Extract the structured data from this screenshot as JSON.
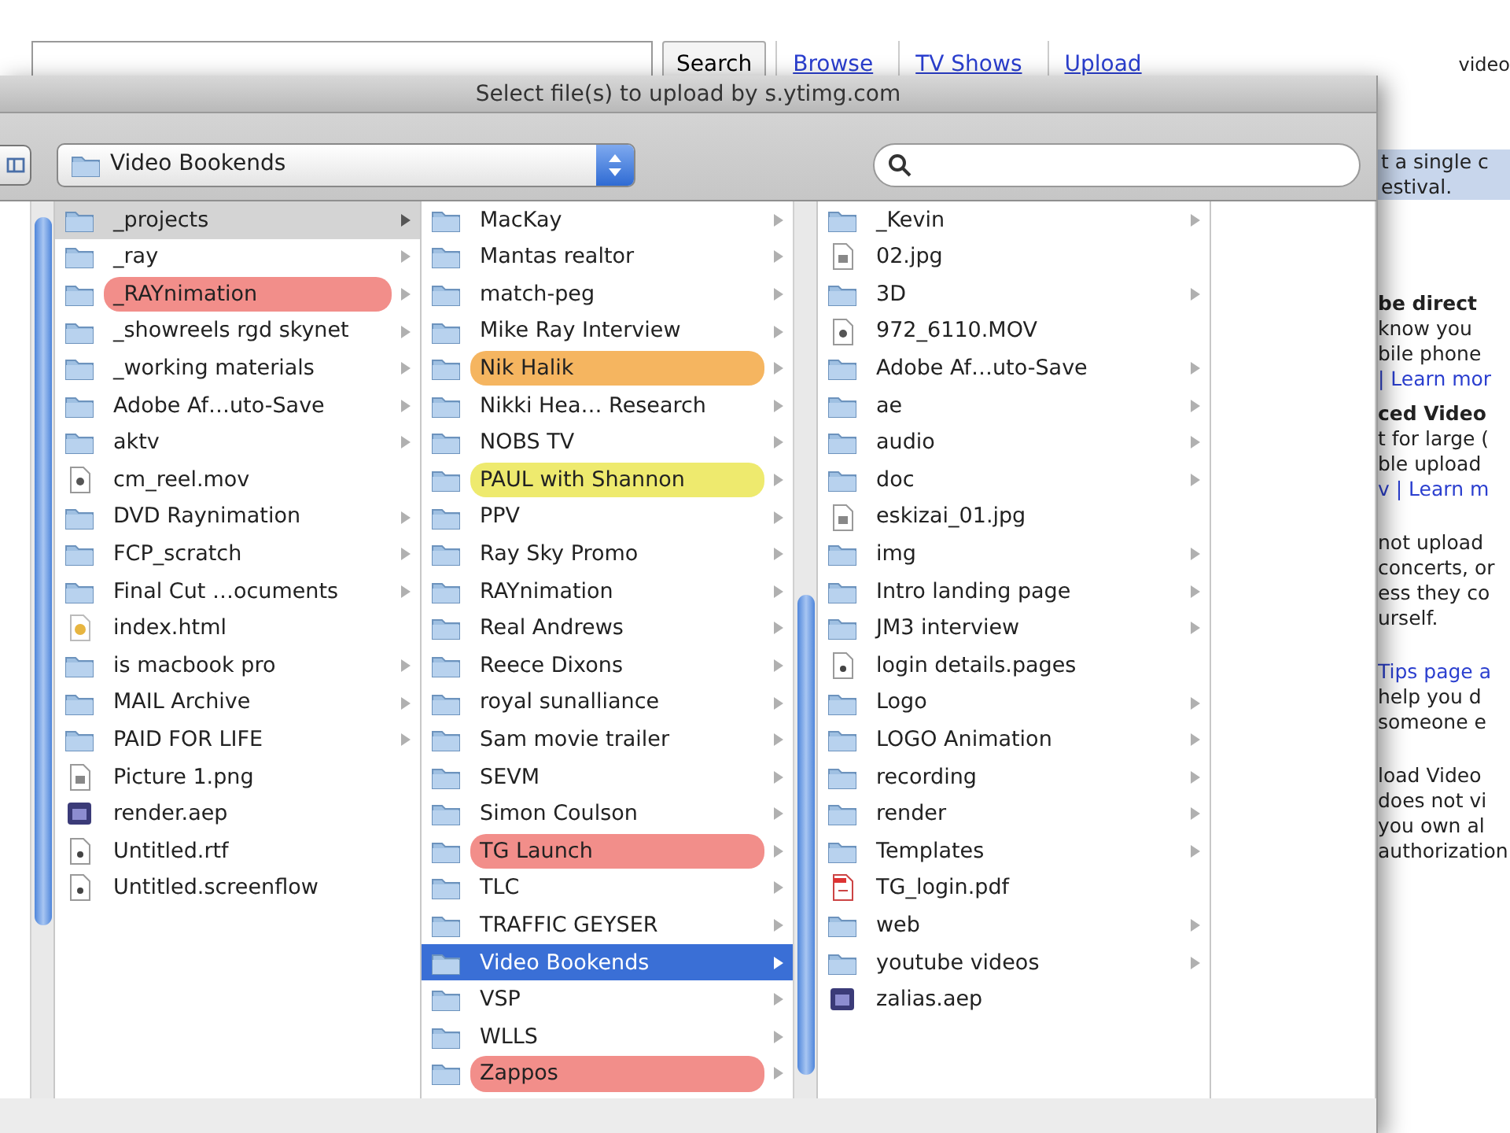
{
  "web_page": {
    "search_button": "Search",
    "nav_links": [
      "Browse",
      "TV Shows",
      "Upload"
    ],
    "account": "video",
    "side_texts": [
      {
        "kind": "notice",
        "text": "t a single c"
      },
      {
        "kind": "notice",
        "text": "estival."
      },
      {
        "kind": "heading",
        "text": "be direct"
      },
      {
        "kind": "text",
        "text": "know you"
      },
      {
        "kind": "text",
        "text": "bile phone"
      },
      {
        "kind": "link",
        "text": "| Learn mor"
      },
      {
        "kind": "heading",
        "text": "ced Video"
      },
      {
        "kind": "text",
        "text": "t for large ("
      },
      {
        "kind": "text",
        "text": "ble upload"
      },
      {
        "kind": "link",
        "text": "v | Learn m"
      },
      {
        "kind": "gap",
        "text": "not upload"
      },
      {
        "kind": "text",
        "text": "concerts, or"
      },
      {
        "kind": "text",
        "text": "ess they co"
      },
      {
        "kind": "text",
        "text": "urself."
      },
      {
        "kind": "link_gap",
        "text": "Tips page a"
      },
      {
        "kind": "text",
        "text": "help you d"
      },
      {
        "kind": "text",
        "text": "someone e"
      },
      {
        "kind": "gap",
        "text": "load Video"
      },
      {
        "kind": "text",
        "text": "does not vi"
      },
      {
        "kind": "text",
        "text": "you own al"
      },
      {
        "kind": "text",
        "text": "authorization"
      }
    ]
  },
  "dialog": {
    "title": "Select file(s) to upload by s.ytimg.com",
    "location": "Video Bookends",
    "columns": [
      {
        "active": false,
        "items": [
          {
            "name": "_projects",
            "kind": "folder",
            "selected": true
          },
          {
            "name": "_ray",
            "kind": "folder",
            "selected": false
          },
          {
            "name": "_RAYnimation",
            "kind": "folder",
            "selected": false,
            "color": "#f28e8a"
          },
          {
            "name": "_showreels rgd skynet",
            "kind": "folder",
            "selected": false
          },
          {
            "name": "_working materials",
            "kind": "folder",
            "selected": false
          },
          {
            "name": "Adobe Af…uto-Save",
            "kind": "folder",
            "selected": false
          },
          {
            "name": "aktv",
            "kind": "folder",
            "selected": false
          },
          {
            "name": "cm_reel.mov",
            "kind": "movie",
            "selected": false
          },
          {
            "name": "DVD Raynimation",
            "kind": "folder",
            "selected": false
          },
          {
            "name": "FCP_scratch",
            "kind": "folder",
            "selected": false
          },
          {
            "name": "Final Cut …ocuments",
            "kind": "folder",
            "selected": false
          },
          {
            "name": "index.html",
            "kind": "html",
            "selected": false
          },
          {
            "name": "is macbook pro",
            "kind": "folder",
            "selected": false
          },
          {
            "name": "MAIL Archive",
            "kind": "folder",
            "selected": false
          },
          {
            "name": "PAID FOR LIFE",
            "kind": "folder",
            "selected": false
          },
          {
            "name": "Picture 1.png",
            "kind": "image",
            "selected": false
          },
          {
            "name": "render.aep",
            "kind": "aep",
            "selected": false
          },
          {
            "name": "Untitled.rtf",
            "kind": "document",
            "selected": false
          },
          {
            "name": "Untitled.screenflow",
            "kind": "document",
            "selected": false
          }
        ]
      },
      {
        "active": true,
        "items": [
          {
            "name": "MacKay",
            "kind": "folder",
            "selected": false
          },
          {
            "name": "Mantas realtor",
            "kind": "folder",
            "selected": false
          },
          {
            "name": "match-peg",
            "kind": "folder",
            "selected": false
          },
          {
            "name": "Mike Ray Interview",
            "kind": "folder",
            "selected": false
          },
          {
            "name": "Nik Halik",
            "kind": "folder",
            "selected": false,
            "color": "#f5b560"
          },
          {
            "name": "Nikki Hea… Research",
            "kind": "folder",
            "selected": false
          },
          {
            "name": "NOBS TV",
            "kind": "folder",
            "selected": false
          },
          {
            "name": "PAUL with Shannon",
            "kind": "folder",
            "selected": false,
            "color": "#eeea6e"
          },
          {
            "name": "PPV",
            "kind": "folder",
            "selected": false
          },
          {
            "name": "Ray Sky Promo",
            "kind": "folder",
            "selected": false
          },
          {
            "name": "RAYnimation",
            "kind": "folder",
            "selected": false
          },
          {
            "name": "Real Andrews",
            "kind": "folder",
            "selected": false
          },
          {
            "name": "Reece Dixons",
            "kind": "folder",
            "selected": false
          },
          {
            "name": "royal sunalliance",
            "kind": "folder",
            "selected": false
          },
          {
            "name": "Sam movie trailer",
            "kind": "folder",
            "selected": false
          },
          {
            "name": "SEVM",
            "kind": "folder",
            "selected": false
          },
          {
            "name": "Simon Coulson",
            "kind": "folder",
            "selected": false
          },
          {
            "name": "TG Launch",
            "kind": "folder",
            "selected": false,
            "color": "#f28e8a"
          },
          {
            "name": "TLC",
            "kind": "folder",
            "selected": false
          },
          {
            "name": "TRAFFIC GEYSER",
            "kind": "folder",
            "selected": false
          },
          {
            "name": "Video Bookends",
            "kind": "folder",
            "selected": true
          },
          {
            "name": "VSP",
            "kind": "folder",
            "selected": false
          },
          {
            "name": "WLLS",
            "kind": "folder",
            "selected": false
          },
          {
            "name": "Zappos",
            "kind": "folder",
            "selected": false,
            "color": "#f28e8a"
          }
        ]
      },
      {
        "items": [
          {
            "name": "_Kevin",
            "kind": "folder",
            "selected": false
          },
          {
            "name": "02.jpg",
            "kind": "image",
            "selected": false
          },
          {
            "name": "3D",
            "kind": "folder",
            "selected": false
          },
          {
            "name": "972_6110.MOV",
            "kind": "movie",
            "selected": false
          },
          {
            "name": "Adobe Af…uto-Save",
            "kind": "folder",
            "selected": false
          },
          {
            "name": "ae",
            "kind": "folder",
            "selected": false
          },
          {
            "name": "audio",
            "kind": "folder",
            "selected": false
          },
          {
            "name": "doc",
            "kind": "folder",
            "selected": false
          },
          {
            "name": "eskizai_01.jpg",
            "kind": "image",
            "selected": false
          },
          {
            "name": "img",
            "kind": "folder",
            "selected": false
          },
          {
            "name": "Intro landing page",
            "kind": "folder",
            "selected": false
          },
          {
            "name": "JM3 interview",
            "kind": "folder",
            "selected": false
          },
          {
            "name": "login details.pages",
            "kind": "document",
            "selected": false
          },
          {
            "name": "Logo",
            "kind": "folder",
            "selected": false
          },
          {
            "name": "LOGO Animation",
            "kind": "folder",
            "selected": false
          },
          {
            "name": "recording",
            "kind": "folder",
            "selected": false
          },
          {
            "name": "render",
            "kind": "folder",
            "selected": false
          },
          {
            "name": "Templates",
            "kind": "folder",
            "selected": false
          },
          {
            "name": "TG_login.pdf",
            "kind": "pdf",
            "selected": false
          },
          {
            "name": "web",
            "kind": "folder",
            "selected": false
          },
          {
            "name": "youtube videos",
            "kind": "folder",
            "selected": false
          },
          {
            "name": "zalias.aep",
            "kind": "aep",
            "selected": false
          }
        ]
      }
    ]
  }
}
